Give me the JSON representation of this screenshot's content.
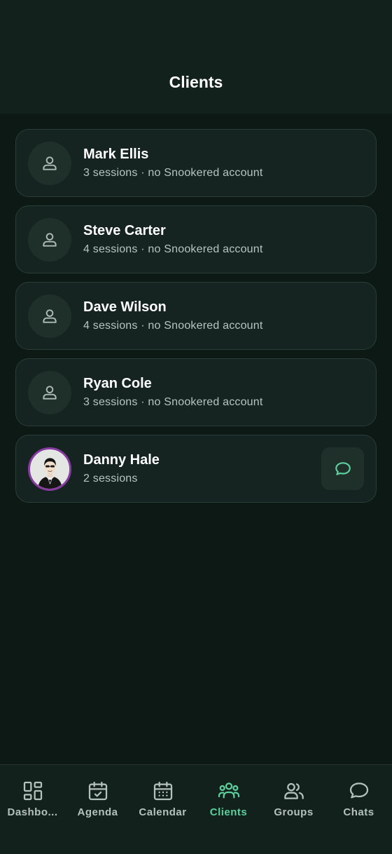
{
  "header": {
    "title": "Clients"
  },
  "clients": [
    {
      "name": "Mark Ellis",
      "meta": "3 sessions · no Snookered account",
      "avatar": "person-icon"
    },
    {
      "name": "Steve Carter",
      "meta": "4 sessions · no Snookered account",
      "avatar": "person-icon"
    },
    {
      "name": "Dave Wilson",
      "meta": "4 sessions · no Snookered account",
      "avatar": "person-icon"
    },
    {
      "name": "Ryan Cole",
      "meta": "3 sessions · no Snookered account",
      "avatar": "person-icon"
    },
    {
      "name": "Danny Hale",
      "meta": "2 sessions",
      "avatar": "photo",
      "action": "chat-bubble-icon"
    }
  ],
  "tabs": [
    {
      "label": "Dashbo...",
      "icon": "dashboard-icon",
      "active": false
    },
    {
      "label": "Agenda",
      "icon": "agenda-icon",
      "active": false
    },
    {
      "label": "Calendar",
      "icon": "calendar-icon",
      "active": false
    },
    {
      "label": "Clients",
      "icon": "clients-icon",
      "active": true
    },
    {
      "label": "Groups",
      "icon": "groups-icon",
      "active": false
    },
    {
      "label": "Chats",
      "icon": "chats-icon",
      "active": false
    }
  ],
  "colors": {
    "background": "#0c1915",
    "surface": "#152420",
    "accent": "#5ccf9c",
    "avatar_ring": "#8a3aa3"
  }
}
